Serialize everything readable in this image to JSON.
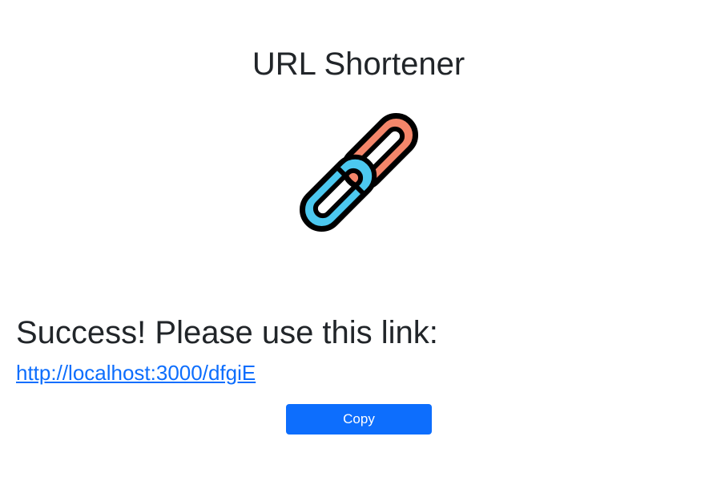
{
  "header": {
    "title": "URL Shortener"
  },
  "logo": {
    "icon": "chain-link-icon",
    "colors": {
      "top_link": "#f4866a",
      "bottom_link": "#4cc8ef",
      "outline": "#000000"
    }
  },
  "result": {
    "message": "Success! Please use this link:",
    "short_url": "http://localhost:3000/dfgiE",
    "copy_label": "Copy"
  },
  "colors": {
    "accent": "#0d6efd",
    "text": "#212529",
    "background": "#ffffff"
  }
}
